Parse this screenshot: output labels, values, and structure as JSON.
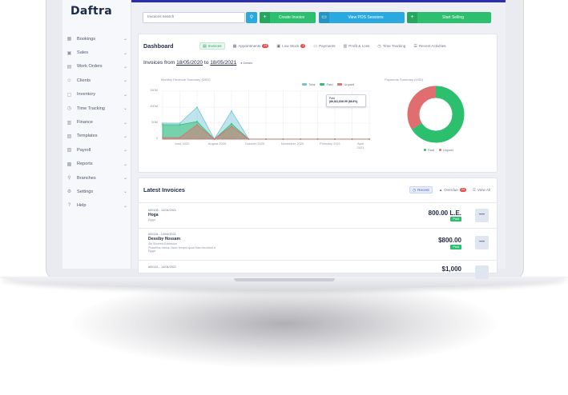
{
  "app": {
    "logo_text": "Daftra",
    "brand_color": "#2a2fb0"
  },
  "sidebar": {
    "items": [
      {
        "label": "Bookings",
        "icon": "calendar-icon"
      },
      {
        "label": "Sales",
        "icon": "tag-icon"
      },
      {
        "label": "Work Orders",
        "icon": "clipboard-icon"
      },
      {
        "label": "Clients",
        "icon": "users-icon"
      },
      {
        "label": "Inventory",
        "icon": "box-icon"
      },
      {
        "label": "Time Tracking",
        "icon": "clock-icon"
      },
      {
        "label": "Finance",
        "icon": "wallet-icon"
      },
      {
        "label": "Templates",
        "icon": "template-icon"
      },
      {
        "label": "Payroll",
        "icon": "money-icon"
      },
      {
        "label": "Reports",
        "icon": "chart-icon"
      },
      {
        "label": "Branches",
        "icon": "branch-icon"
      },
      {
        "label": "Settings",
        "icon": "gear-icon"
      },
      {
        "label": "Help",
        "icon": "help-icon"
      }
    ]
  },
  "topbar": {
    "search_placeholder": "Invoices search",
    "create_invoice": "Create Invoice",
    "view_pos": "View POS Sessions",
    "start_selling": "Start Selling"
  },
  "dashboard": {
    "title": "Dashboard",
    "tabs": [
      {
        "label": "Invoices",
        "active": true
      },
      {
        "label": "Appointments",
        "badge": "24"
      },
      {
        "label": "Low Stock",
        "badge": "3"
      },
      {
        "label": "Payments"
      },
      {
        "label": "Profit & Loss"
      },
      {
        "label": "Time Tracking"
      },
      {
        "label": "Recent Activities"
      }
    ],
    "range_prefix": "Invoices from",
    "date_from": "18/05/2020",
    "range_to": "to",
    "date_to": "18/05/2021",
    "details": "Details"
  },
  "chart_data": [
    {
      "type": "area",
      "title": "Monthly Revenue Summary (USD)",
      "legend": [
        "Total",
        "Paid",
        "Unpaid"
      ],
      "colors": {
        "Total": "#72c3d6",
        "Paid": "#2cbf6e",
        "Unpaid": "#e06e6e"
      },
      "y_ticks": [
        "150M",
        "100M",
        "50M",
        "0"
      ],
      "x_ticks": [
        "June 2020",
        "August 2020",
        "October 2020",
        "November 2020",
        "February 2021",
        "April 2021"
      ],
      "ylim": [
        0,
        150
      ],
      "x": [
        0,
        1,
        2,
        3,
        4,
        5,
        6,
        7,
        8,
        9,
        10,
        11,
        12
      ],
      "series": [
        {
          "name": "Total",
          "values": [
            50,
            50,
            100,
            0,
            88,
            0,
            0,
            0,
            0,
            0,
            0,
            0,
            0
          ]
        },
        {
          "name": "Paid",
          "values": [
            45,
            45,
            55,
            0,
            48,
            0,
            0,
            0,
            0,
            0,
            0,
            0,
            0
          ]
        },
        {
          "name": "Unpaid",
          "values": [
            5,
            5,
            45,
            0,
            40,
            0,
            0,
            0,
            0,
            0,
            0,
            0,
            0
          ]
        }
      ]
    },
    {
      "type": "pie",
      "title": "Payments Summary (USD)",
      "labels": [
        "Paid",
        "Unpaid"
      ],
      "values": [
        66,
        34
      ],
      "colors": [
        "#2cbf6e",
        "#e06e6e"
      ],
      "tooltip_label": "Paid",
      "tooltip_value": "(66,811,836.99 (66.8%)"
    }
  ],
  "latest_invoices": {
    "title": "Latest Invoices",
    "tabs": [
      {
        "label": "Recent",
        "active": true
      },
      {
        "label": "Overdue",
        "badge": "24"
      },
      {
        "label": "View All"
      }
    ],
    "rows": [
      {
        "meta": "#00108 - 14/04/2021",
        "name": "Hoga",
        "sub1": "Egypt",
        "sub2": "",
        "sub3": "",
        "amount": "800.00 L.E.",
        "status": "Paid"
      },
      {
        "meta": "#00116 - 14/04/2021",
        "name": "Dessiby Hossam",
        "sub1": "4th Silvered Extension",
        "sub2": "Phasellus metus. Nunc tempor quod Nam tincidunt a",
        "sub3": "Egypt",
        "amount": "$800.00",
        "status": "Paid"
      },
      {
        "meta": "#00141 - 14/04/2021",
        "name": "",
        "sub1": "",
        "sub2": "",
        "sub3": "",
        "amount": "$1,000",
        "status": ""
      }
    ]
  }
}
